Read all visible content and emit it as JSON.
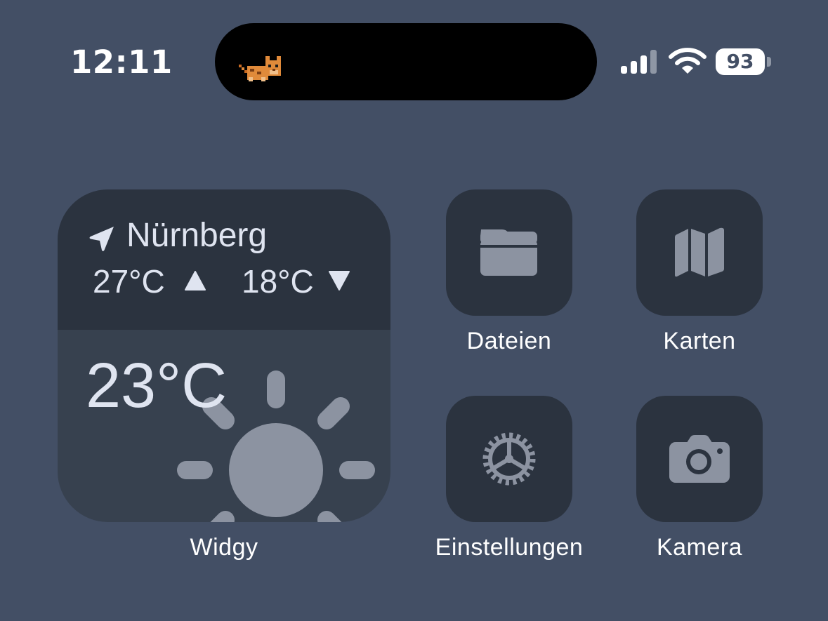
{
  "status_bar": {
    "time": "12:11",
    "battery_level": "93"
  },
  "widget": {
    "name": "Widgy",
    "location": "Nürnberg",
    "high": "27°C",
    "low": "18°C",
    "current": "23°C",
    "icons": {
      "location": "location-arrow-icon",
      "high": "triangle-up-icon",
      "low": "triangle-down-icon",
      "condition": "sun-icon"
    }
  },
  "apps": [
    {
      "label": "Dateien",
      "icon": "folder-icon"
    },
    {
      "label": "Karten",
      "icon": "map-icon"
    },
    {
      "label": "Einstellungen",
      "icon": "gear-icon"
    },
    {
      "label": "Kamera",
      "icon": "camera-icon"
    }
  ],
  "colors": {
    "wallpaper": "#434f65",
    "tile": "#2b333f",
    "widget_body": "#37414f",
    "glyph": "#8c93a1",
    "text": "#ffffff",
    "widget_text": "#dfe4f0"
  }
}
